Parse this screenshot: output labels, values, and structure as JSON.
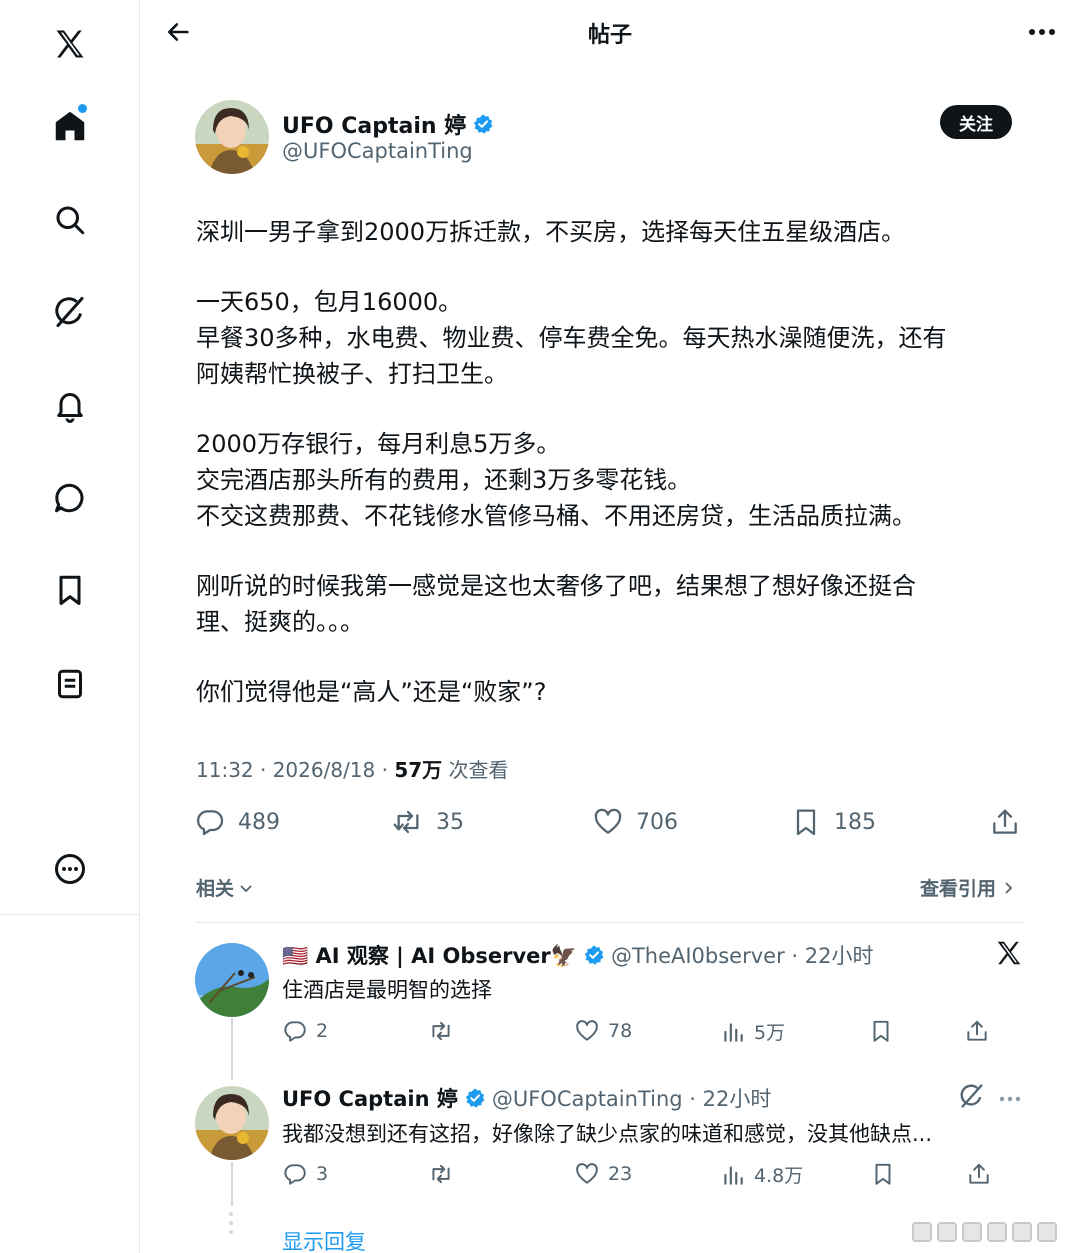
{
  "header": {
    "title": "帖子"
  },
  "sidebar": {
    "items": [
      "x-logo-icon",
      "home-icon",
      "search-icon",
      "grok-icon",
      "notifications-icon",
      "messages-icon",
      "bookmarks-icon",
      "lists-icon",
      "more-icon"
    ]
  },
  "tweet": {
    "display_name": "UFO Captain 婷",
    "handle": "@UFOCaptainTing",
    "follow_label": "关注",
    "paragraphs": [
      [
        "深圳一男子拿到2000万拆迁款，不买房，选择每天住五星级酒店。"
      ],
      [
        "一天650，包月16000。",
        "早餐30多种，水电费、物业费、停车费全免。每天热水澡随便洗，还有",
        "阿姨帮忙换被子、打扫卫生。"
      ],
      [
        "2000万存银行，每月利息5万多。",
        "交完酒店那头所有的费用，还剩3万多零花钱。",
        "不交这费那费、不花钱修水管修马桶、不用还房贷，生活品质拉满。"
      ],
      [
        "刚听说的时候我第一感觉是这也太奢侈了吧，结果想了想好像还挺合",
        "理、挺爽的。。。"
      ],
      [
        "你们觉得他是“高人”还是“败家”?"
      ]
    ],
    "time": "11:32 · 2026/8/18 · ",
    "views": "57万",
    "views_label": " 次查看",
    "stats": {
      "replies": "489",
      "retweets": "35",
      "likes": "706",
      "bookmarks": "185"
    }
  },
  "related_label": "相关",
  "quotes_label": "查看引用",
  "replies": [
    {
      "display_name": "🇺🇸 AI 观察 | AI Observer🦅",
      "handle": "@TheAI0bserver · 22小时",
      "text": "住酒店是最明智的选择",
      "stats": {
        "replies": "2",
        "retweets": "",
        "likes": "78",
        "views": "5万"
      }
    },
    {
      "display_name": "UFO Captain 婷",
      "handle": "@UFOCaptainTing · 22小时",
      "text": "我都没想到还有这招，好像除了缺少点家的味道和感觉，没其他缺点...",
      "stats": {
        "replies": "3",
        "retweets": "",
        "likes": "23",
        "views": "4.8万"
      }
    }
  ],
  "show_replies_label": "显示回复",
  "colors": {
    "accent": "#1d9bf0",
    "text": "#0f1419",
    "muted": "#536471"
  }
}
